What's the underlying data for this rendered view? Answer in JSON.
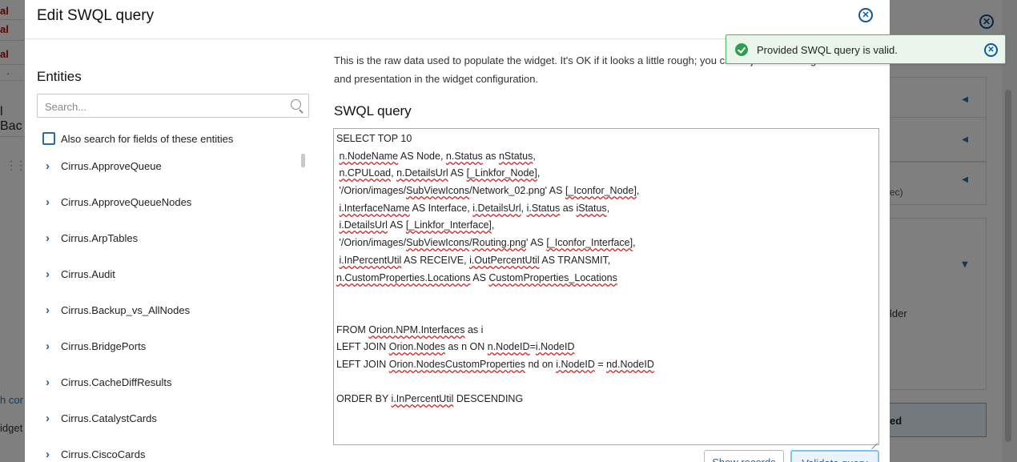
{
  "background": {
    "left_fragments": {
      "red_1": "al",
      "red_2": "al",
      "red_3": "al",
      "dot": "·",
      "heading_fragment": "l Bac",
      "link_fragment": "h cor",
      "widget_fragment": "idget"
    },
    "right_fragments": {
      "sec_fragment": "ec)",
      "older_fragment": "lder",
      "button_fragment": "ed"
    }
  },
  "modal": {
    "title": "Edit SWQL query",
    "close_icon": "close-circle-icon",
    "entities": {
      "title": "Entities",
      "search_placeholder": "Search...",
      "search_value": "",
      "also_search_label": "Also search for fields of these entities",
      "also_search_checked": false,
      "items": [
        "Cirrus.ApproveQueue",
        "Cirrus.ApproveQueueNodes",
        "Cirrus.ArpTables",
        "Cirrus.Audit",
        "Cirrus.Backup_vs_AllNodes",
        "Cirrus.BridgePorts",
        "Cirrus.CacheDiffResults",
        "Cirrus.CatalystCards",
        "Cirrus.CiscoCards"
      ]
    },
    "description_line_1": "This is the raw data used to populate the widget. It's OK if it looks a little rough; you can adjust formatting",
    "description_line_2": "and presentation in the widget configuration.",
    "swql_title": "SWQL query",
    "query_lines": [
      "SELECT TOP 10",
      " n.NodeName AS Node, n.Status as nStatus,",
      " n.CPULoad, n.DetailsUrl AS [_Linkfor_Node],",
      " '/Orion/images/SubViewIcons/Network_02.png' AS [_Iconfor_Node],",
      " i.InterfaceName AS Interface, i.DetailsUrl, i.Status as iStatus,",
      " i.DetailsUrl AS [_Linkfor_Interface],",
      " '/Orion/images/SubViewIcons/Routing.png' AS [_Iconfor_Interface],",
      " i.InPercentUtil AS RECEIVE, i.OutPercentUtil AS TRANSMIT,",
      "n.CustomProperties.Locations AS CustomProperties_Locations",
      "",
      "",
      "FROM Orion.NPM.Interfaces as i",
      "LEFT JOIN Orion.Nodes as n ON n.NodeID=i.NodeID",
      "LEFT JOIN Orion.NodesCustomProperties nd on i.NodeID = nd.NodeID",
      "",
      "ORDER BY i.InPercentUtil DESCENDING"
    ],
    "buttons": {
      "show_records": "Show records",
      "validate_query": "Validate query"
    }
  },
  "toast": {
    "message": "Provided SWQL query is valid.",
    "status": "success",
    "status_color": "#2f9e4f",
    "icon": "check-circle-icon",
    "close_icon": "close-circle-icon"
  },
  "colors": {
    "accent": "#1a5f9e",
    "error_underline": "#d02020"
  }
}
